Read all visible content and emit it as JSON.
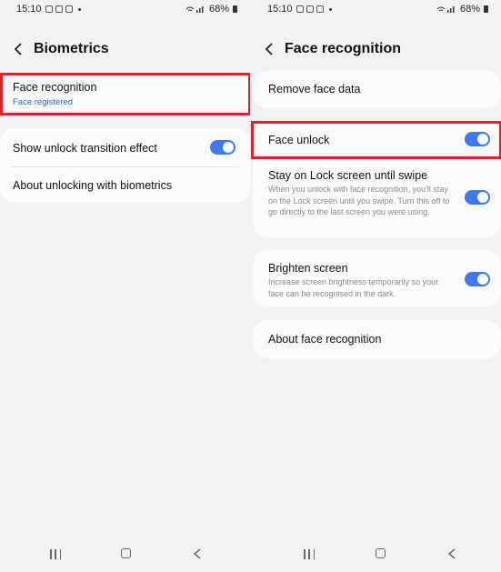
{
  "left": {
    "status": {
      "time": "15:10",
      "battery": "68%"
    },
    "header": {
      "title": "Biometrics"
    },
    "face_recognition": {
      "label": "Face recognition",
      "sub": "Face registered"
    },
    "transition_effect": {
      "label": "Show unlock transition effect",
      "toggle": true
    },
    "about": {
      "label": "About unlocking with biometrics"
    }
  },
  "right": {
    "status": {
      "time": "15:10",
      "battery": "68%"
    },
    "header": {
      "title": "Face recognition"
    },
    "remove": {
      "label": "Remove face data"
    },
    "face_unlock": {
      "label": "Face unlock",
      "toggle": true
    },
    "stay_lock": {
      "label": "Stay on Lock screen until swipe",
      "desc": "When you unlock with face recognition, you'll stay on the Lock screen until you swipe. Turn this off to go directly to the last screen you were using.",
      "toggle": true
    },
    "brighten": {
      "label": "Brighten screen",
      "desc": "Increase screen brightness temporarily so your face can be recognised in the dark.",
      "toggle": true
    },
    "about": {
      "label": "About face recognition"
    }
  },
  "colors": {
    "accent": "#3d79e8",
    "highlight": "#d7262c",
    "sub_text": "#2a64c6"
  }
}
